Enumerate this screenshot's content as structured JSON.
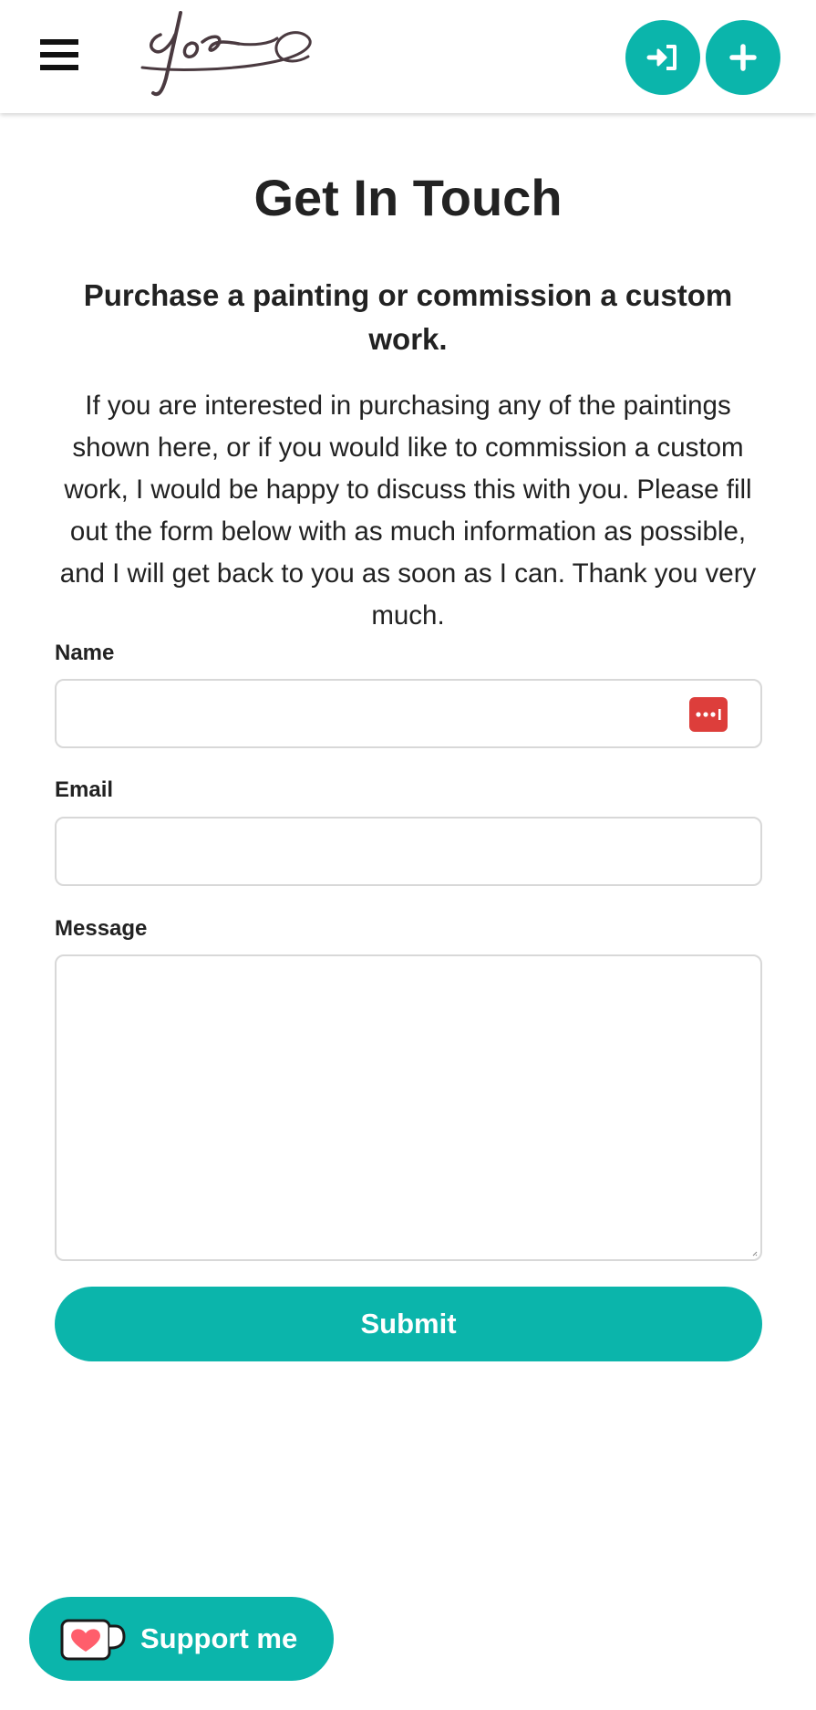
{
  "header": {
    "menu_icon": "hamburger-menu-icon",
    "logo_icon": "signature-logo",
    "login_icon": "sign-in-icon",
    "add_icon": "plus-icon",
    "accent_color": "#0bb5ab"
  },
  "page": {
    "title": "Get In Touch",
    "subtitle": "Purchase a painting or commission a custom work.",
    "intro": "If you are interested in purchasing any of the paintings shown here, or if you would like to commission a custom work, I would be happy to discuss this with you. Please fill out the form below with as much information as possible, and I will get back to you as soon as I can. Thank you very much."
  },
  "form": {
    "name_label": "Name",
    "name_value": "",
    "name_autofill_icon": "password-manager-icon",
    "email_label": "Email",
    "email_value": "",
    "message_label": "Message",
    "message_value": "",
    "submit_label": "Submit"
  },
  "support": {
    "label": "Support me",
    "icon": "kofi-cup-icon",
    "color": "#0bb5ab"
  }
}
